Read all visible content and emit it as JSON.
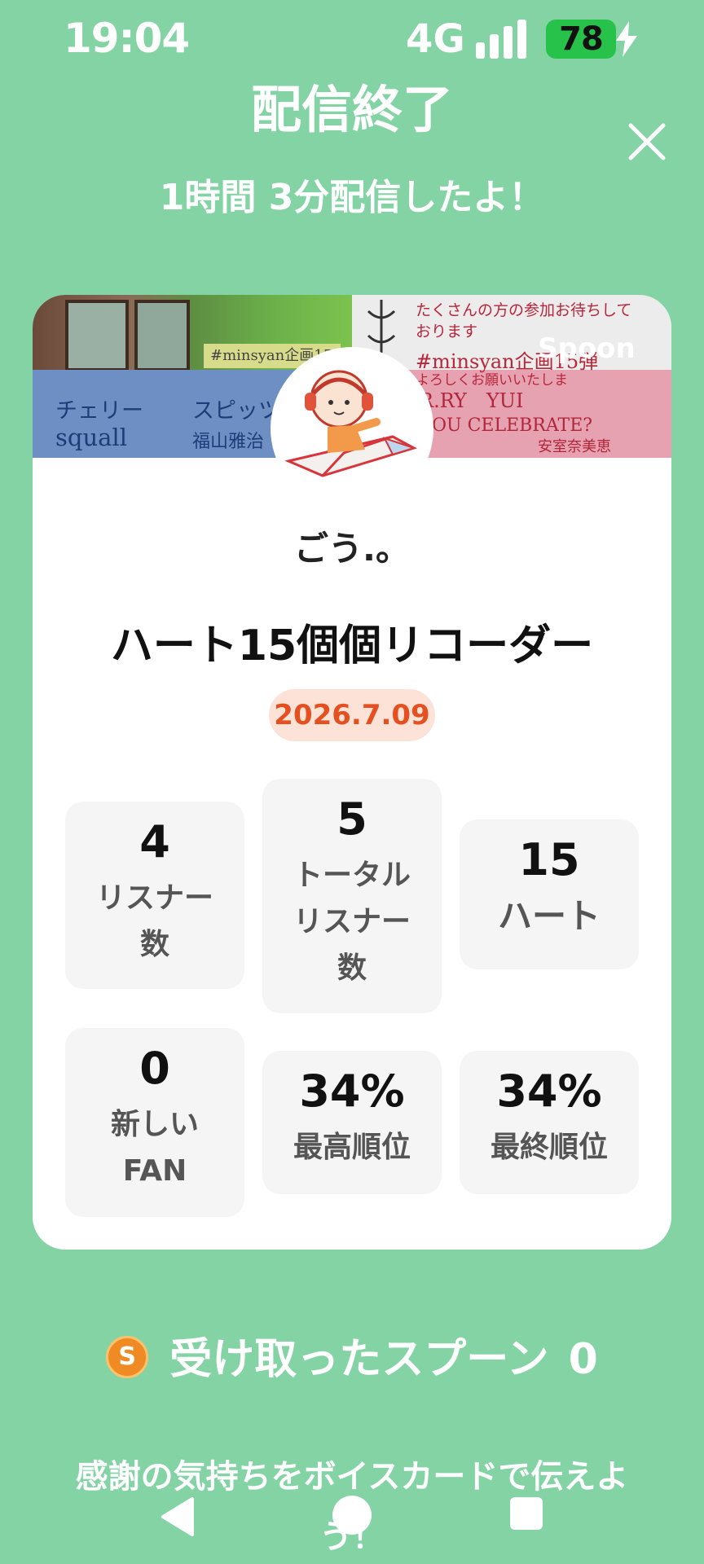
{
  "status_bar": {
    "time": "19:04",
    "network": "4G",
    "battery": "78"
  },
  "header": {
    "title": "配信終了",
    "duration": "1時間 3分配信したよ！"
  },
  "card": {
    "banner": {
      "tag": "#minsyan企画15",
      "left_song1": "チェリー",
      "left_artist1": "スピッツ",
      "left_song2": "squall",
      "left_artist2": "福山雅治",
      "right_notice1": "たくさんの方の参加お待ちして",
      "right_notice2": "おります",
      "right_hashtag": "#minsyan企画15弾",
      "right_notice3": "よろしくお願いいたしま",
      "right_song1": "R.RY　YUI",
      "right_song2": "OU CELEBRATE?",
      "right_artist2": "安室奈美恵",
      "logo": "Spoon"
    },
    "username": "ごう.。",
    "live_title": "ハート15個個リコーダー",
    "date": "2026.7.09",
    "stats": [
      {
        "value": "4",
        "label_lines": [
          "リスナー",
          "数"
        ]
      },
      {
        "value": "5",
        "label_lines": [
          "トータル",
          "リスナー",
          "数"
        ]
      },
      {
        "value": "15",
        "label_lines": [
          "ハート"
        ]
      },
      {
        "value": "0",
        "label_lines": [
          "新しい",
          "FAN"
        ]
      },
      {
        "value": "34%",
        "label_lines": [
          "最高順位"
        ]
      },
      {
        "value": "34%",
        "label_lines": [
          "最終順位"
        ]
      }
    ]
  },
  "spoon": {
    "coin_symbol": "S",
    "label": "受け取ったスプーン",
    "count": "0"
  },
  "footer": {
    "voice_card_line1": "感謝の気持ちをボイスカードで伝えよ",
    "voice_card_line2": "う！"
  },
  "colors": {
    "background": "#83d3a5",
    "accent": "#e4501f",
    "battery": "#27c24a"
  }
}
